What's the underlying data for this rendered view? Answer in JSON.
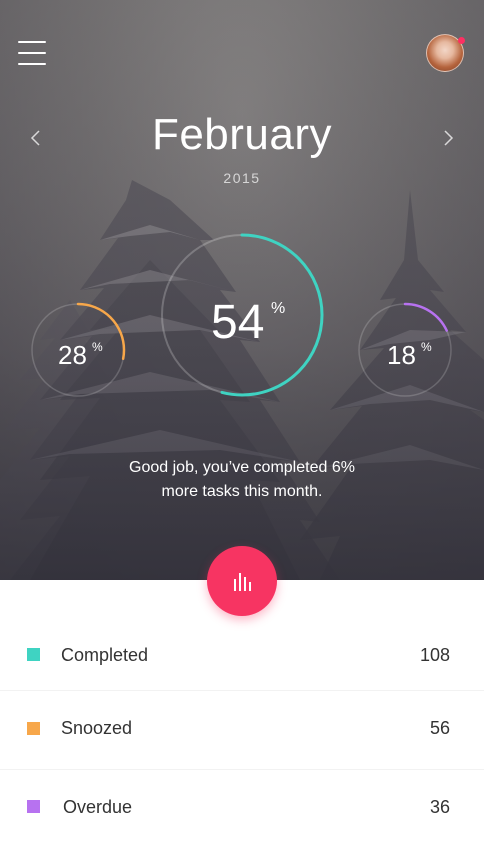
{
  "header": {
    "menu_icon": "hamburger-menu-icon",
    "avatar_icon": "user-avatar",
    "notification_color": "#ff2f62",
    "prev_icon": "chevron-left-icon",
    "next_icon": "chevron-right-icon",
    "month": "February",
    "year": "2015"
  },
  "stats": {
    "main": {
      "value": "54",
      "unit": "%",
      "fraction": 0.54,
      "color": "#3fd3c2"
    },
    "left": {
      "value": "28",
      "unit": "%",
      "fraction": 0.28,
      "color": "#f7a74a"
    },
    "right": {
      "value": "18",
      "unit": "%",
      "fraction": 0.18,
      "color": "#b772f0"
    }
  },
  "message": {
    "line1": "Good job, you’ve completed 6%",
    "line2": "more tasks this month."
  },
  "fab": {
    "icon": "bar-chart-icon",
    "color": "#f73462"
  },
  "legend": [
    {
      "label": "Completed",
      "count": "108",
      "color": "#3fd3c2"
    },
    {
      "label": "Snoozed",
      "count": "56",
      "color": "#f7a74a"
    },
    {
      "label": "Overdue",
      "count": "36",
      "color": "#b772f0"
    }
  ]
}
